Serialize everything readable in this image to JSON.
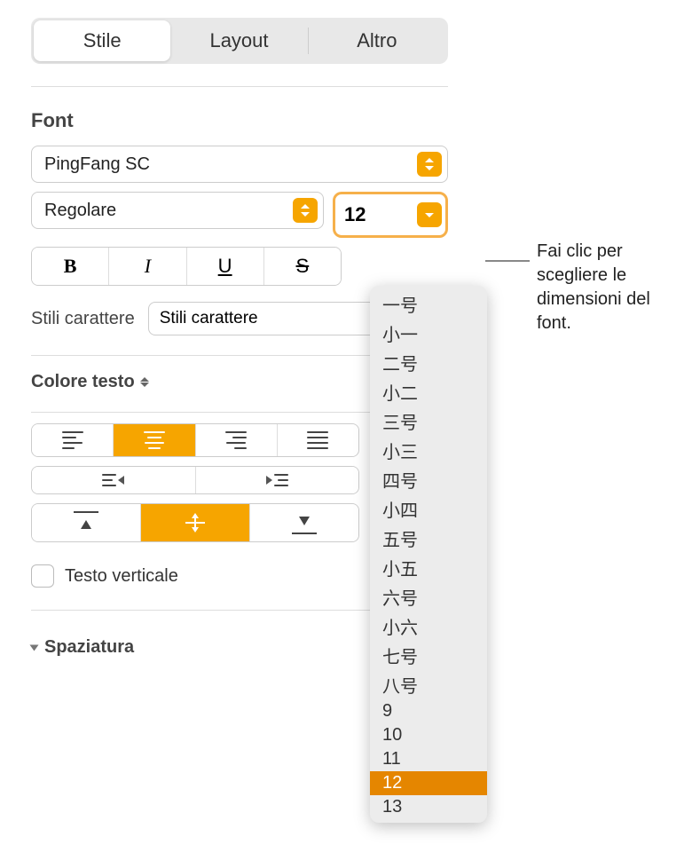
{
  "tabs": {
    "style": "Stile",
    "layout": "Layout",
    "other": "Altro"
  },
  "font": {
    "section": "Font",
    "family": "PingFang SC",
    "style": "Regolare",
    "size": "12",
    "format": {
      "b": "B",
      "i": "I",
      "u": "U",
      "s": "S"
    }
  },
  "char_styles": {
    "label": "Stili carattere",
    "value": "Stili carattere"
  },
  "text_color": {
    "label": "Colore testo"
  },
  "vertical_text": {
    "label": "Testo verticale"
  },
  "spacing": {
    "label": "Spaziatura"
  },
  "size_menu": {
    "items": [
      "一号",
      "小一",
      "二号",
      "小二",
      "三号",
      "小三",
      "四号",
      "小四",
      "五号",
      "小五",
      "六号",
      "小六",
      "七号",
      "八号",
      "9",
      "10",
      "11",
      "12",
      "13"
    ],
    "selected": "12"
  },
  "callout": "Fai clic per scegliere le dimensioni del font."
}
